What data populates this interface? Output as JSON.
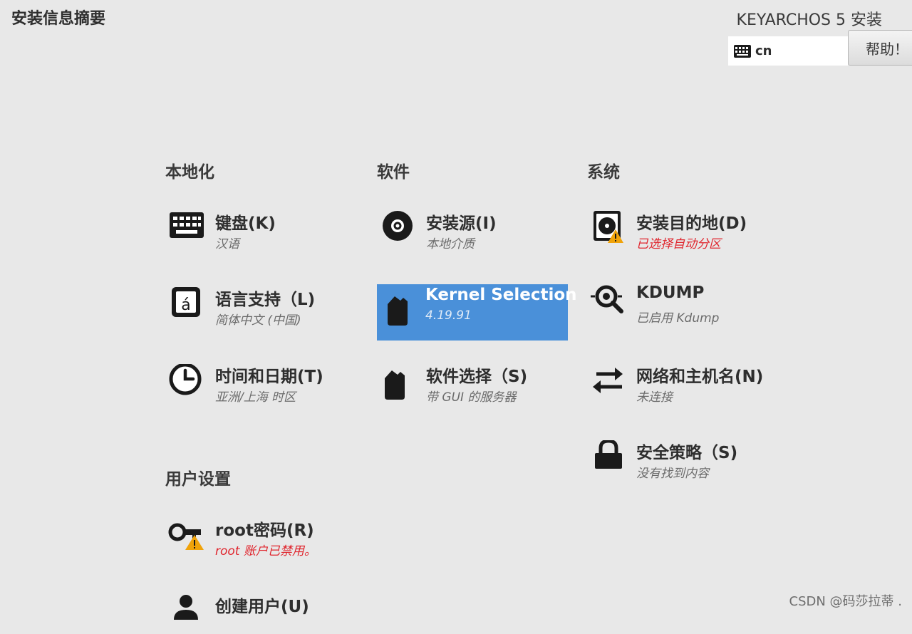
{
  "header": {
    "page_title": "安装信息摘要",
    "product_title": "KEYARCHOS 5 安装",
    "keyboard_layout": "cn",
    "help_label": "帮助！"
  },
  "sections": {
    "localization": "本地化",
    "software": "软件",
    "system": "系统",
    "user_settings": "用户设置"
  },
  "spokes": {
    "keyboard": {
      "name": "键盘(K)",
      "status": "汉语",
      "icon": "keyboard-icon"
    },
    "language": {
      "name": "语言支持（L)",
      "status": "简体中文 (中国)",
      "icon": "language-icon"
    },
    "datetime": {
      "name": "时间和日期(T)",
      "status": "亚洲/上海 时区",
      "icon": "clock-icon"
    },
    "source": {
      "name": "安装源(I)",
      "status": "本地介质",
      "icon": "disc-icon"
    },
    "kernel": {
      "name": "Kernel Selection",
      "status": "4.19.91",
      "icon": "package-icon"
    },
    "software_selection": {
      "name": "软件选择（S)",
      "status": "带 GUI 的服务器",
      "icon": "package-icon"
    },
    "destination": {
      "name": "安装目的地(D)",
      "status": "已选择自动分区",
      "icon": "disk-warning-icon"
    },
    "kdump": {
      "name": "KDUMP",
      "status": "已启用 Kdump",
      "icon": "magnifier-icon"
    },
    "network": {
      "name": "网络和主机名(N)",
      "status": "未连接",
      "icon": "arrows-icon"
    },
    "security": {
      "name": "安全策略（S)",
      "status": "没有找到内容",
      "icon": "lock-icon"
    },
    "root": {
      "name": "root密码(R)",
      "status": "root 账户已禁用。",
      "icon": "key-warning-icon"
    },
    "user": {
      "name": "创建用户(U)",
      "icon": "user-icon"
    }
  },
  "colors": {
    "selected": "#4a90d9",
    "warning_text": "#e0252d",
    "warning_badge": "#f0a30a",
    "background": "#e8e8e8"
  },
  "watermark": "CSDN @码莎拉蒂 ."
}
